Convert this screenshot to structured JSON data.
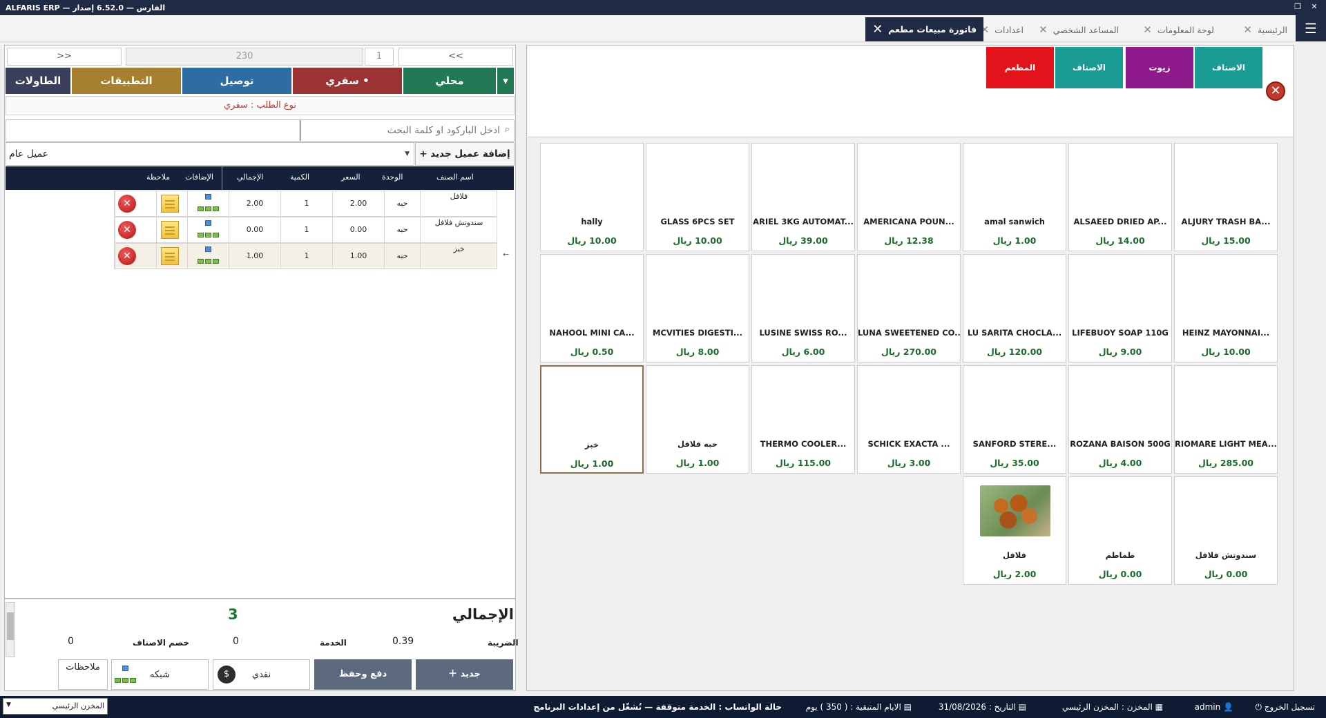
{
  "title_bar": {
    "text": "ALFARIS ERP  —  الفارس  —  6.52.0 إصدار"
  },
  "tabs": [
    {
      "label": "الرئيسية"
    },
    {
      "label": "لوحة المعلومات"
    },
    {
      "label": "المساعد الشخصي"
    },
    {
      "label": "اعدادات"
    },
    {
      "label": "فاتورة مبيعات مطعم"
    }
  ],
  "nav": {
    "prev": "<<",
    "next": ">>",
    "invoice_no": "230",
    "page": "1"
  },
  "order_types": {
    "tables": "الطاولات",
    "apps": "التطبيقات",
    "delivery": "توصيل",
    "takeaway": "سفري •",
    "local": "محلي",
    "dropdown": "▾"
  },
  "order_type_label": "نوع الطلب : سفري",
  "search": {
    "placeholder": "ادخل الباركود او كلمة البحث"
  },
  "customer": {
    "add_label": "إضافة عميل جديد +",
    "selected": "عميل عام"
  },
  "table": {
    "headers": {
      "name": "اسم الصنف",
      "unit": "الوحدة",
      "price": "السعر",
      "qty": "الكمية",
      "total": "الإجمالي",
      "addons": "الإضافات",
      "note": "ملاحظة"
    },
    "rows": [
      {
        "name": "فلافل",
        "unit": "حبه",
        "price": "2.00",
        "qty": "1",
        "total": "2.00"
      },
      {
        "name": "سندوتش فلافل",
        "unit": "حبه",
        "price": "0.00",
        "qty": "1",
        "total": "0.00"
      },
      {
        "name": "خبز",
        "unit": "حبه",
        "price": "1.00",
        "qty": "1",
        "total": "1.00"
      }
    ]
  },
  "totals": {
    "grand_label": "الإجمالي",
    "grand_value": "3",
    "tax_label": "الضريبة",
    "tax_value": "0.39",
    "service_label": "الخدمة",
    "service_value": "0",
    "discount_label": "خصم الاصناف",
    "discount_value": "0"
  },
  "actions": {
    "new": "جديد",
    "pay_save": "دفع وحفظ",
    "cash": "نقدي",
    "network": "شبكه",
    "notes": "ملاحظات"
  },
  "categories": [
    {
      "label": "الاصناف",
      "color": "#1a9c94"
    },
    {
      "label": "زيوت",
      "color": "#8e1a8c"
    },
    {
      "label": "الاصناف",
      "color": "#1a9c94"
    },
    {
      "label": "المطعم",
      "color": "#e3131b"
    }
  ],
  "products": [
    {
      "name": "ALJURY TRASH BA...",
      "price": "15.00 ريال"
    },
    {
      "name": "ALSAEED DRIED AP...",
      "price": "14.00 ريال"
    },
    {
      "name": "amal sanwich",
      "price": "1.00 ريال"
    },
    {
      "name": "AMERICANA POUN...",
      "price": "12.38 ريال"
    },
    {
      "name": "ARIEL 3KG AUTOMAT...",
      "price": "39.00 ريال"
    },
    {
      "name": "GLASS 6PCS SET",
      "price": "10.00 ريال"
    },
    {
      "name": "hally",
      "price": "10.00 ريال"
    },
    {
      "name": "HEINZ MAYONNAI...",
      "price": "10.00 ريال"
    },
    {
      "name": "LIFEBUOY SOAP 110G",
      "price": "9.00 ريال"
    },
    {
      "name": "LU SARITA CHOCLA...",
      "price": "120.00 ريال"
    },
    {
      "name": "LUNA SWEETENED CO...",
      "price": "270.00 ريال"
    },
    {
      "name": "LUSINE SWISS RO...",
      "price": "6.00 ريال"
    },
    {
      "name": "MCVITIES DIGESTI...",
      "price": "8.00 ريال"
    },
    {
      "name": "NAHOOL MINI CA...",
      "price": "0.50 ريال"
    },
    {
      "name": "RIOMARE LIGHT MEA...",
      "price": "285.00 ريال"
    },
    {
      "name": "ROZANA BAISON 500G",
      "price": "4.00 ريال"
    },
    {
      "name": "SANFORD STERE...",
      "price": "35.00 ريال"
    },
    {
      "name": "SCHICK EXACTA ...",
      "price": "3.00 ريال"
    },
    {
      "name": "THERMO COOLER...",
      "price": "115.00 ريال"
    },
    {
      "name": "حبه فلافل",
      "price": "1.00 ريال"
    },
    {
      "name": "خبز",
      "price": "1.00 ريال"
    },
    {
      "name": "سندوتش فلافل",
      "price": "0.00 ريال"
    },
    {
      "name": "طماطم",
      "price": "0.00 ريال"
    },
    {
      "name": "فلافل",
      "price": "2.00 ريال"
    }
  ],
  "status_bar": {
    "logout": "تسجيل الخروج",
    "user": "admin",
    "store": "المخزن : المخزن الرئيسي",
    "date": "التاريخ : 31/08/2026",
    "days_left": "الايام المتبقية : ( 350 ) يوم",
    "whatsapp": "حالة الواتساب :  الخدمة متوقفة — تُشغّل من إعدادات البرنامج",
    "store_select": "المخزن الرئيسي"
  }
}
